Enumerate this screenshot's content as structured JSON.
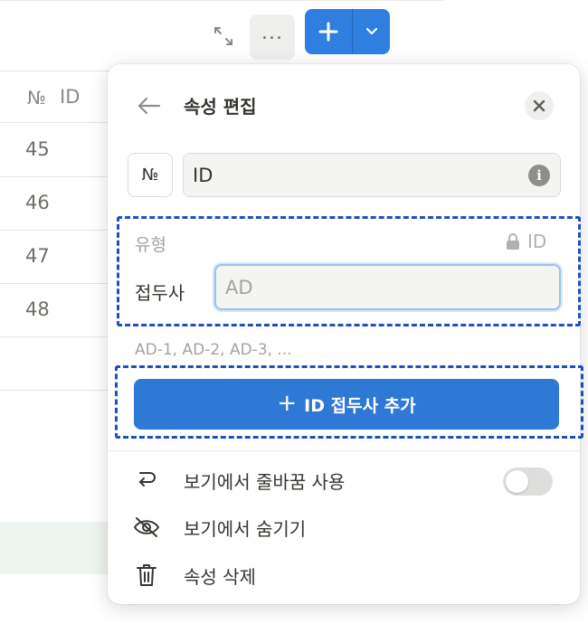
{
  "table": {
    "header_icon": "№",
    "header_label": "ID",
    "rows": [
      "45",
      "46",
      "47",
      "48"
    ]
  },
  "toolbar": {
    "expand_icon": "expand-icon",
    "more_label": "...",
    "new_icon": "plus-icon",
    "dropdown_icon": "chevron-down-icon",
    "accent": "#2f7fe0"
  },
  "panel": {
    "title": "속성 편집",
    "property_icon": "№",
    "property_name": "ID",
    "type_label": "유형",
    "type_value": "ID",
    "prefix_label": "접두사",
    "prefix_placeholder": "AD",
    "example": "AD-1, AD-2, AD-3, ...",
    "add_prefix_label": "ID 접두사 추가",
    "menu": [
      {
        "label": "보기에서 줄바꿈 사용",
        "icon": "wrap-icon",
        "toggle_on": false
      },
      {
        "label": "보기에서 숨기기",
        "icon": "eye-off-icon"
      },
      {
        "label": "속성 삭제",
        "icon": "trash-icon"
      }
    ]
  },
  "colors": {
    "button_blue": "#2f79d6",
    "highlight": "#1c4fc2"
  }
}
